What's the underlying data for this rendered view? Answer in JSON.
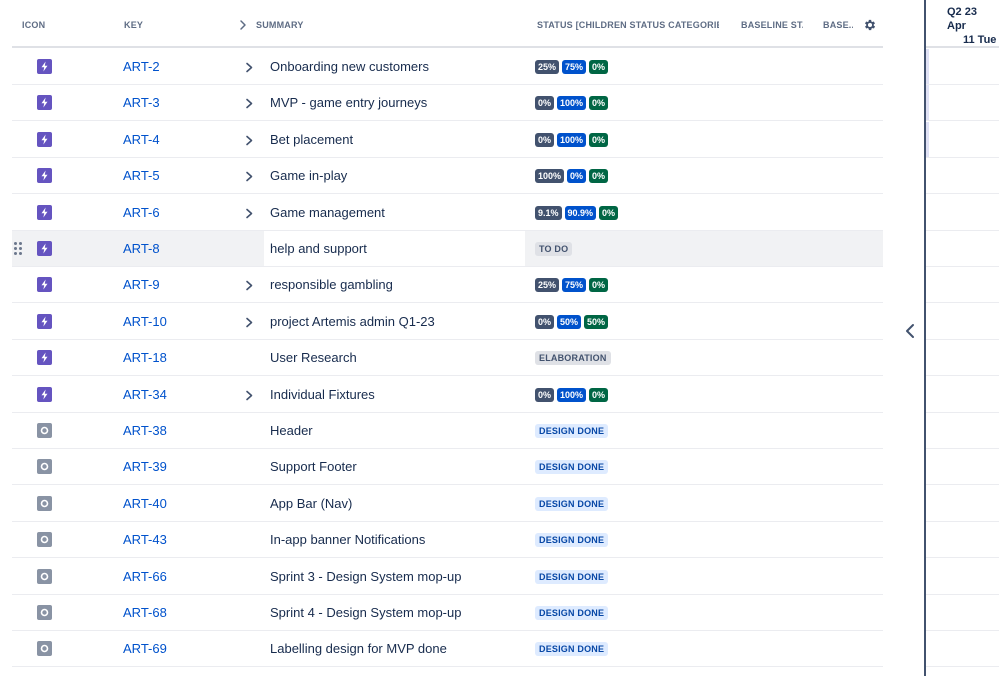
{
  "header": {
    "icon": "ICON",
    "key": "KEY",
    "summary": "SUMMARY",
    "status": "STATUS [CHILDREN STATUS CATEGORIES I...",
    "baseline_start": "BASELINE ST...",
    "baseline_end": "BASE..."
  },
  "timeline": {
    "quarter": "Q2 23",
    "month": "Apr",
    "day": "11 Tue"
  },
  "colors": {
    "epic": "#6554c0",
    "task": "#8993a4",
    "key_link": "#0052cc",
    "todo": "#42526e",
    "in_progress": "#0052cc",
    "done": "#006644"
  },
  "rows": [
    {
      "type": "epic",
      "key": "ART-2",
      "expandable": true,
      "summary": "Onboarding new customers",
      "progress": [
        "25%",
        "75%",
        "0%"
      ]
    },
    {
      "type": "epic",
      "key": "ART-3",
      "expandable": true,
      "summary": "MVP - game entry journeys",
      "progress": [
        "0%",
        "100%",
        "0%"
      ]
    },
    {
      "type": "epic",
      "key": "ART-4",
      "expandable": true,
      "summary": "Bet placement",
      "progress": [
        "0%",
        "100%",
        "0%"
      ]
    },
    {
      "type": "epic",
      "key": "ART-5",
      "expandable": true,
      "summary": "Game in-play",
      "progress": [
        "100%",
        "0%",
        "0%"
      ]
    },
    {
      "type": "epic",
      "key": "ART-6",
      "expandable": true,
      "summary": "Game management",
      "progress": [
        "9.1%",
        "90.9%",
        "0%"
      ]
    },
    {
      "type": "epic",
      "key": "ART-8",
      "expandable": false,
      "summary": "help and support",
      "lozenge": "TO DO",
      "lozenge_style": "todo",
      "highlighted": true
    },
    {
      "type": "epic",
      "key": "ART-9",
      "expandable": true,
      "summary": "responsible gambling",
      "progress": [
        "25%",
        "75%",
        "0%"
      ]
    },
    {
      "type": "epic",
      "key": "ART-10",
      "expandable": true,
      "summary": "project Artemis admin Q1-23",
      "progress": [
        "0%",
        "50%",
        "50%"
      ]
    },
    {
      "type": "epic",
      "key": "ART-18",
      "expandable": false,
      "summary": "User Research",
      "lozenge": "ELABORATION",
      "lozenge_style": "todo"
    },
    {
      "type": "epic",
      "key": "ART-34",
      "expandable": true,
      "summary": "Individual Fixtures",
      "progress": [
        "0%",
        "100%",
        "0%"
      ]
    },
    {
      "type": "task",
      "key": "ART-38",
      "expandable": false,
      "summary": "Header",
      "lozenge": "DESIGN DONE",
      "lozenge_style": "done"
    },
    {
      "type": "task",
      "key": "ART-39",
      "expandable": false,
      "summary": "Support Footer",
      "lozenge": "DESIGN DONE",
      "lozenge_style": "done"
    },
    {
      "type": "task",
      "key": "ART-40",
      "expandable": false,
      "summary": "App Bar (Nav)",
      "lozenge": "DESIGN DONE",
      "lozenge_style": "done"
    },
    {
      "type": "task",
      "key": "ART-43",
      "expandable": false,
      "summary": "In-app banner Notifications",
      "lozenge": "DESIGN DONE",
      "lozenge_style": "done"
    },
    {
      "type": "task",
      "key": "ART-66",
      "expandable": false,
      "summary": "Sprint 3 - Design System mop-up",
      "lozenge": "DESIGN DONE",
      "lozenge_style": "done"
    },
    {
      "type": "task",
      "key": "ART-68",
      "expandable": false,
      "summary": "Sprint 4 - Design System mop-up",
      "lozenge": "DESIGN DONE",
      "lozenge_style": "done"
    },
    {
      "type": "task",
      "key": "ART-69",
      "expandable": false,
      "summary": "Labelling design for MVP done",
      "lozenge": "DESIGN DONE",
      "lozenge_style": "done"
    }
  ]
}
